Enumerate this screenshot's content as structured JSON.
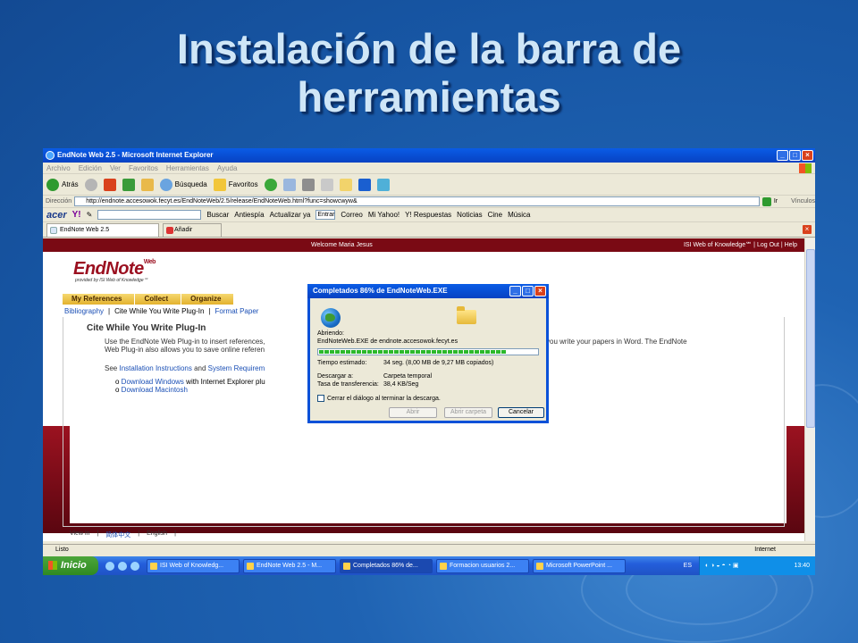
{
  "slide": {
    "title_line1": "Instalación de la barra de",
    "title_line2": "herramientas"
  },
  "ie": {
    "window_title": "EndNote Web 2.5 - Microsoft Internet Explorer",
    "menu": [
      "Archivo",
      "Edición",
      "Ver",
      "Favoritos",
      "Herramientas",
      "Ayuda"
    ],
    "toolbar": {
      "back": "Atrás",
      "search": "Búsqueda",
      "favorites": "Favoritos"
    },
    "address_label": "Dirección",
    "address_value": "http://endnote.accesowok.fecyt.es/EndNoteWeb/2.5/release/EndNoteWeb.html?func=showcwyw&",
    "go_label": "Ir",
    "links_label": "Vínculos",
    "acer_toolbar": {
      "acer": "acer",
      "yahoo": "Y!",
      "search_btn": "Buscar",
      "antiespia": "Antiespía",
      "update": "Actualizar ya",
      "entrar": "Entrar",
      "correo": "Correo",
      "mi_yahoo": "Mi Yahoo!",
      "respuestas": "Y! Respuestas",
      "noticias": "Noticias",
      "cine": "Cine",
      "musica": "Música"
    },
    "tabs": [
      {
        "label": "EndNote Web 2.5"
      },
      {
        "label": "Añadir pestaña"
      }
    ],
    "status_left": "Listo",
    "status_zone": "Internet"
  },
  "page": {
    "welcome": "Welcome Maria Jesus",
    "isi_link": "ISI Web of Knowledge℠",
    "logout": "Log Out",
    "help": "Help",
    "logo": "EndNote",
    "logo_sup": "Web",
    "logo_sub": "provided by ISI Web of Knowledge℠",
    "nav_tabs": [
      "My References",
      "Collect",
      "Organize"
    ],
    "sub_nav": [
      "Bibliography",
      "Cite While You Write Plug-In",
      "Format Paper"
    ],
    "panel_heading": "Cite While You Write Plug-In",
    "para1_a": "Use the EndNote Web Plug-in to insert references,",
    "para1_b": "you write your papers in Word. The EndNote",
    "para1_c": "Web Plug-in also allows you to save online referen",
    "see": "See",
    "install_link": "Installation Instructions",
    "and": "and",
    "sysreq_link": "System Requirem",
    "dl_windows": "Download Windows",
    "dl_windows_tail": "with Internet Explorer plu",
    "dl_mac": "Download Macintosh",
    "lang": [
      "View in",
      "简体中文",
      "English"
    ]
  },
  "dialog": {
    "title": "Completados 86% de EndNoteWeb.EXE",
    "opening_label": "Abriendo:",
    "opening_value": "EndNoteWeb.EXE de endnote.accesowok.fecyt.es",
    "progress": 0.86,
    "time_label": "Tiempo estimado:",
    "time_value": "34 seg. (8,00 MB de 9,27 MB copiados)",
    "download_to_label": "Descargar a:",
    "download_to_value": "Carpeta temporal",
    "rate_label": "Tasa de transferencia:",
    "rate_value": "38,4 KB/Seg",
    "close_checkbox": "Cerrar el diálogo al terminar la descarga.",
    "btn_open": "Abrir",
    "btn_open_folder": "Abrir carpeta",
    "btn_cancel": "Cancelar"
  },
  "taskbar": {
    "start": "Inicio",
    "tasks": [
      "ISI Web of Knowledg...",
      "EndNote Web 2.5 - M...",
      "Completados 86% de...",
      "Formacion usuarios 2...",
      "Microsoft PowerPoint ..."
    ],
    "lang": "ES",
    "clock": "13:40"
  },
  "colors": {
    "slide_bg": "#1f63b3",
    "title": "#cfe6f7",
    "endnote_red": "#9b1020",
    "nav_gold": "#e3b22e",
    "link_blue": "#1a4fb5",
    "xp_blue": "#0a5ce6"
  }
}
